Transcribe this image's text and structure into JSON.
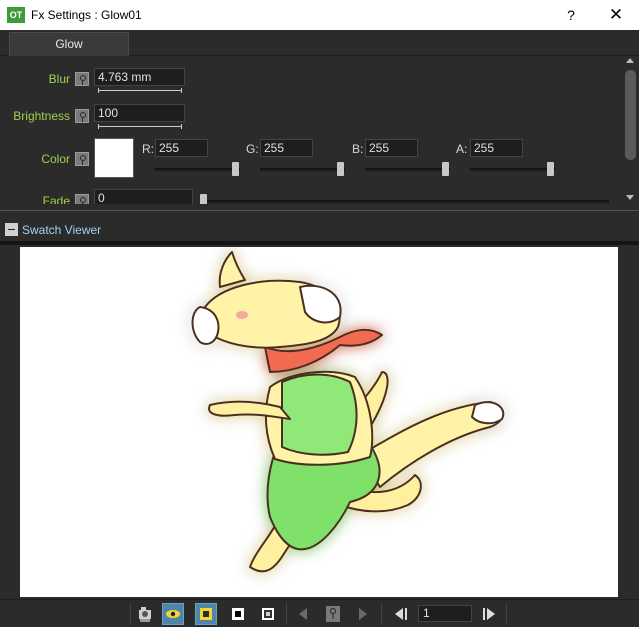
{
  "window": {
    "icon_text": "OT",
    "title": "Fx Settings : Glow01",
    "help_label": "?",
    "close_label": "✕"
  },
  "tabs": [
    {
      "label": "Glow",
      "active": true
    }
  ],
  "params": {
    "blur": {
      "label": "Blur",
      "value": "4.763 mm"
    },
    "brightness": {
      "label": "Brightness",
      "value": "100"
    },
    "color": {
      "label": "Color",
      "swatch": "#ffffff",
      "channels": [
        {
          "label": "R:",
          "value": "255",
          "level": 1.0
        },
        {
          "label": "G:",
          "value": "255",
          "level": 1.0
        },
        {
          "label": "B:",
          "value": "255",
          "level": 1.0
        },
        {
          "label": "A:",
          "value": "255",
          "level": 1.0
        }
      ]
    },
    "fade": {
      "label": "Fade",
      "value": "0",
      "level": 0.0
    }
  },
  "swatch_viewer": {
    "title": "Swatch Viewer",
    "expanded": true
  },
  "toolbar": {
    "frame": "1",
    "buttons": [
      "camera-stand-icon",
      "eye-icon",
      "checker-bg-icon",
      "black-bg-icon",
      "white-bg-icon",
      "prev-key-icon",
      "key-icon",
      "next-key-icon",
      "first-frame-icon",
      "next-frame-icon"
    ]
  },
  "colors": {
    "label_green": "#9fd34b",
    "link_blue": "#9fd2f0",
    "active_blue": "#4f86a8",
    "background": "#2b2b2b"
  }
}
